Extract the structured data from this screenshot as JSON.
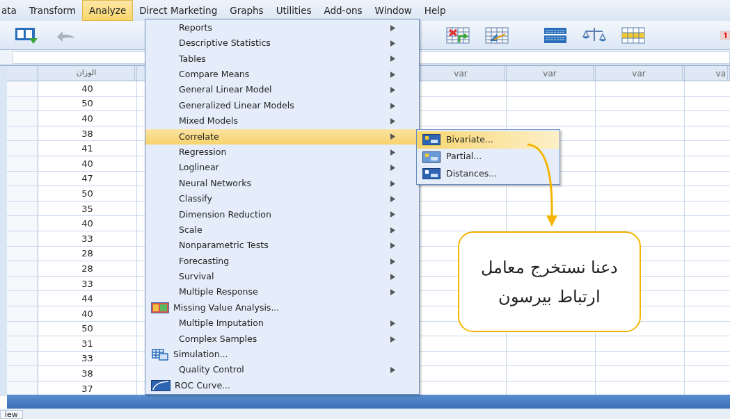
{
  "menubar": [
    {
      "label": "ata",
      "selected": false
    },
    {
      "label": "Transform",
      "selected": false
    },
    {
      "label": "Analyze",
      "selected": true
    },
    {
      "label": "Direct Marketing",
      "selected": false
    },
    {
      "label": "Graphs",
      "selected": false
    },
    {
      "label": "Utilities",
      "selected": false
    },
    {
      "label": "Add-ons",
      "selected": false
    },
    {
      "label": "Window",
      "selected": false
    },
    {
      "label": "Help",
      "selected": false
    }
  ],
  "grid": {
    "columns": [
      "الوزان",
      "var",
      "var",
      "var",
      "va"
    ],
    "rows": [
      "40",
      "50",
      "40",
      "38",
      "41",
      "40",
      "47",
      "50",
      "35",
      "40",
      "33",
      "28",
      "28",
      "33",
      "44",
      "40",
      "50",
      "31",
      "33",
      "38",
      "37"
    ]
  },
  "analyze_menu": [
    {
      "label": "Reports",
      "kind": "submenu",
      "selected": false
    },
    {
      "label": "Descriptive Statistics",
      "kind": "submenu",
      "selected": false
    },
    {
      "label": "Tables",
      "kind": "submenu",
      "selected": false
    },
    {
      "label": "Compare Means",
      "kind": "submenu",
      "selected": false
    },
    {
      "label": "General Linear Model",
      "kind": "submenu",
      "selected": false
    },
    {
      "label": "Generalized Linear Models",
      "kind": "submenu",
      "selected": false
    },
    {
      "label": "Mixed Models",
      "kind": "submenu",
      "selected": false
    },
    {
      "label": "Correlate",
      "kind": "submenu",
      "selected": true
    },
    {
      "label": "Regression",
      "kind": "submenu",
      "selected": false
    },
    {
      "label": "Loglinear",
      "kind": "submenu",
      "selected": false
    },
    {
      "label": "Neural Networks",
      "kind": "submenu",
      "selected": false
    },
    {
      "label": "Classify",
      "kind": "submenu",
      "selected": false
    },
    {
      "label": "Dimension Reduction",
      "kind": "submenu",
      "selected": false
    },
    {
      "label": "Scale",
      "kind": "submenu",
      "selected": false
    },
    {
      "label": "Nonparametric Tests",
      "kind": "submenu",
      "selected": false
    },
    {
      "label": "Forecasting",
      "kind": "submenu",
      "selected": false
    },
    {
      "label": "Survival",
      "kind": "submenu",
      "selected": false
    },
    {
      "label": "Multiple Response",
      "kind": "submenu",
      "selected": false
    },
    {
      "label": "Missing Value Analysis...",
      "kind": "missing",
      "selected": false
    },
    {
      "label": "Multiple Imputation",
      "kind": "submenu",
      "selected": false
    },
    {
      "label": "Complex Samples",
      "kind": "submenu",
      "selected": false
    },
    {
      "label": "Simulation...",
      "kind": "simulation",
      "selected": false
    },
    {
      "label": "Quality Control",
      "kind": "submenu",
      "selected": false
    },
    {
      "label": "ROC Curve...",
      "kind": "roc",
      "selected": false
    }
  ],
  "correlate_menu": [
    {
      "label": "Bivariate...",
      "selected": true
    },
    {
      "label": "Partial...",
      "selected": false
    },
    {
      "label": "Distances...",
      "selected": false
    }
  ],
  "callout": {
    "lines": [
      "دعنا نستخرج معامل",
      "ارتباط بيرسون"
    ]
  },
  "bottom_tab": "iew"
}
